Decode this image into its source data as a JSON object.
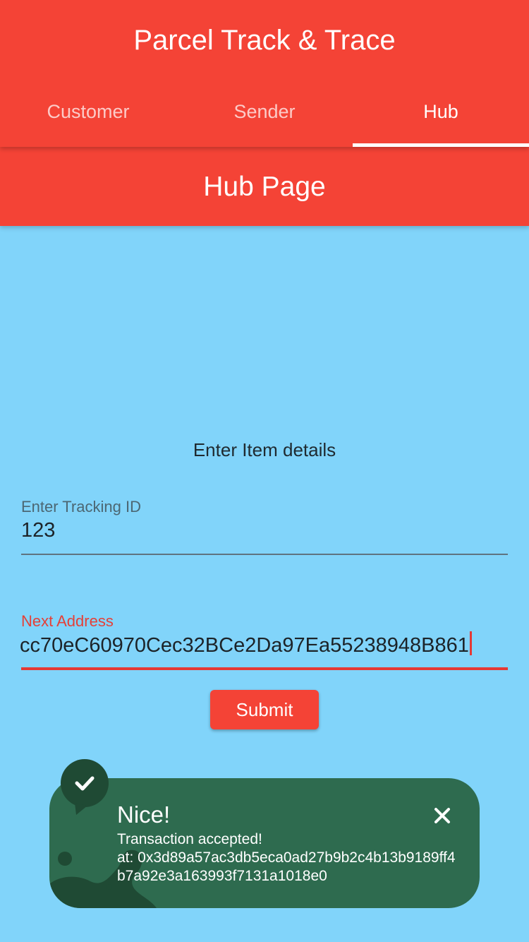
{
  "app": {
    "title": "Parcel Track & Trace"
  },
  "tabs": [
    {
      "label": "Customer",
      "active": false
    },
    {
      "label": "Sender",
      "active": false
    },
    {
      "label": "Hub",
      "active": true
    }
  ],
  "page": {
    "title": "Hub Page"
  },
  "form": {
    "section_title": "Enter Item details",
    "tracking": {
      "label": "Enter Tracking ID",
      "value": "123"
    },
    "address": {
      "label": "Next Address",
      "value": "cc70eC60970Cec32BCe2Da97Ea55238948B861"
    },
    "submit_label": "Submit"
  },
  "toast": {
    "title": "Nice!",
    "line1": "Transaction accepted!",
    "line2": "at: 0x3d89a57ac3db5eca0ad27b9b2c4b13b9189ff4b7a92e3a163993f7131a1018e0",
    "icons": {
      "badge": "check-icon",
      "close": "close-icon"
    }
  },
  "colors": {
    "primary": "#f44336",
    "background": "#81d4fa",
    "toast_bg": "#2e6b4f",
    "toast_dark": "#1f4a34",
    "error": "#e53935"
  }
}
